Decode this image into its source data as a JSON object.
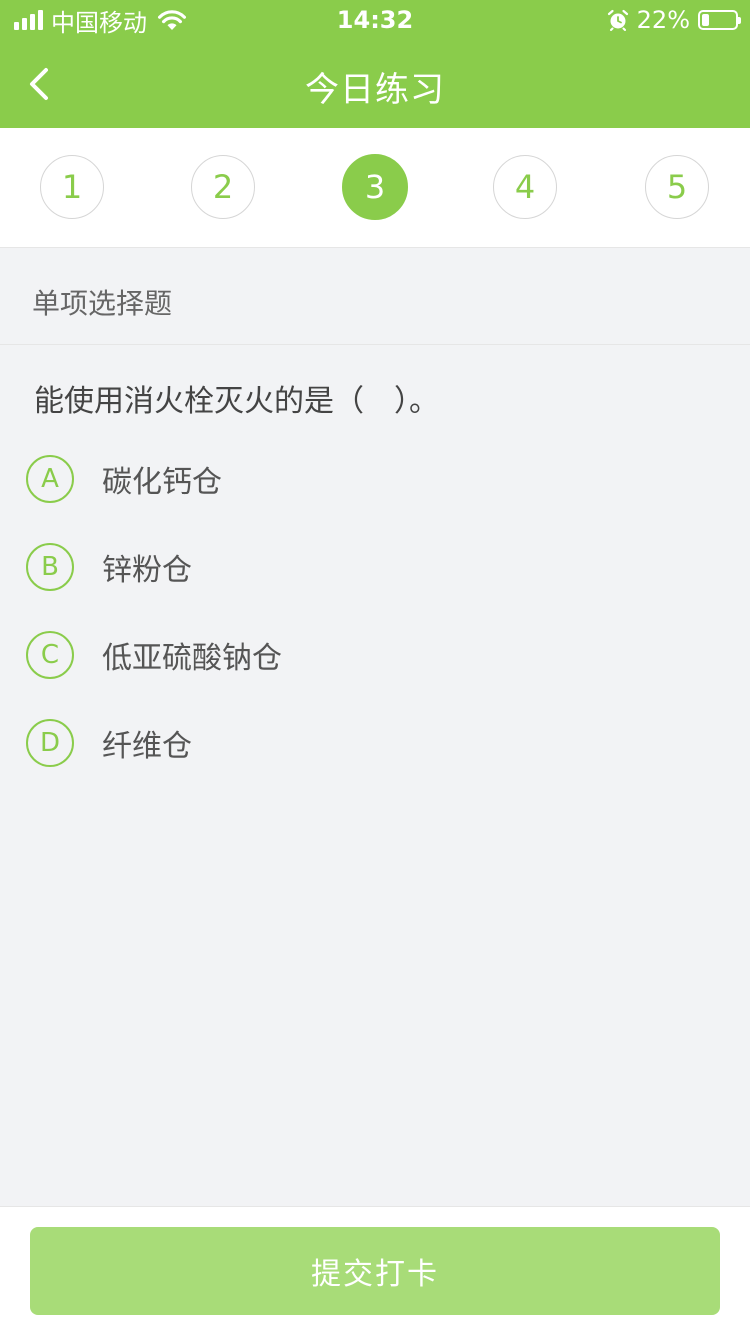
{
  "status_bar": {
    "carrier": "中国移动",
    "time": "14:32",
    "battery_percent": "22%",
    "battery_level": 0.22,
    "icons": [
      "signal-icon",
      "wifi-icon",
      "alarm-icon",
      "battery-icon"
    ]
  },
  "nav": {
    "title": "今日练习",
    "back_icon": "chevron-left-icon"
  },
  "steps": {
    "items": [
      "1",
      "2",
      "3",
      "4",
      "5"
    ],
    "active_index": 2
  },
  "question_type": "单项选择题",
  "question": {
    "text": "能使用消火栓灭火的是（　）。",
    "options": [
      {
        "letter": "A",
        "text": "碳化钙仓"
      },
      {
        "letter": "B",
        "text": "锌粉仓"
      },
      {
        "letter": "C",
        "text": "低亚硫酸钠仓"
      },
      {
        "letter": "D",
        "text": "纤维仓"
      }
    ]
  },
  "submit_label": "提交打卡",
  "colors": {
    "accent": "#8acc4b",
    "button_disabled": "#a8dc78",
    "background": "#f2f3f5"
  }
}
